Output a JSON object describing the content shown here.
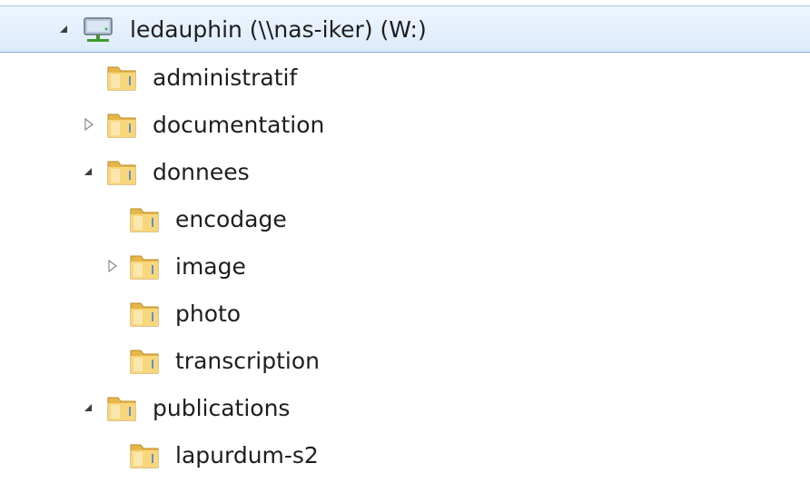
{
  "tree": {
    "root": {
      "label": "ledauphin (\\\\nas-iker) (W:)",
      "icon": "network-drive-icon",
      "expanded": true,
      "selected": true
    },
    "items": [
      {
        "label": "administratif",
        "icon": "folder-icon",
        "expander": "none"
      },
      {
        "label": "documentation",
        "icon": "folder-icon",
        "expander": "collapsed"
      },
      {
        "label": "donnees",
        "icon": "folder-icon",
        "expander": "expanded"
      },
      {
        "label": "encodage",
        "icon": "folder-icon",
        "expander": "none"
      },
      {
        "label": "image",
        "icon": "folder-icon",
        "expander": "collapsed"
      },
      {
        "label": "photo",
        "icon": "folder-icon",
        "expander": "none"
      },
      {
        "label": "transcription",
        "icon": "folder-icon",
        "expander": "none"
      },
      {
        "label": "publications",
        "icon": "folder-icon",
        "expander": "expanded"
      },
      {
        "label": "lapurdum-s2",
        "icon": "folder-icon",
        "expander": "none"
      }
    ]
  }
}
